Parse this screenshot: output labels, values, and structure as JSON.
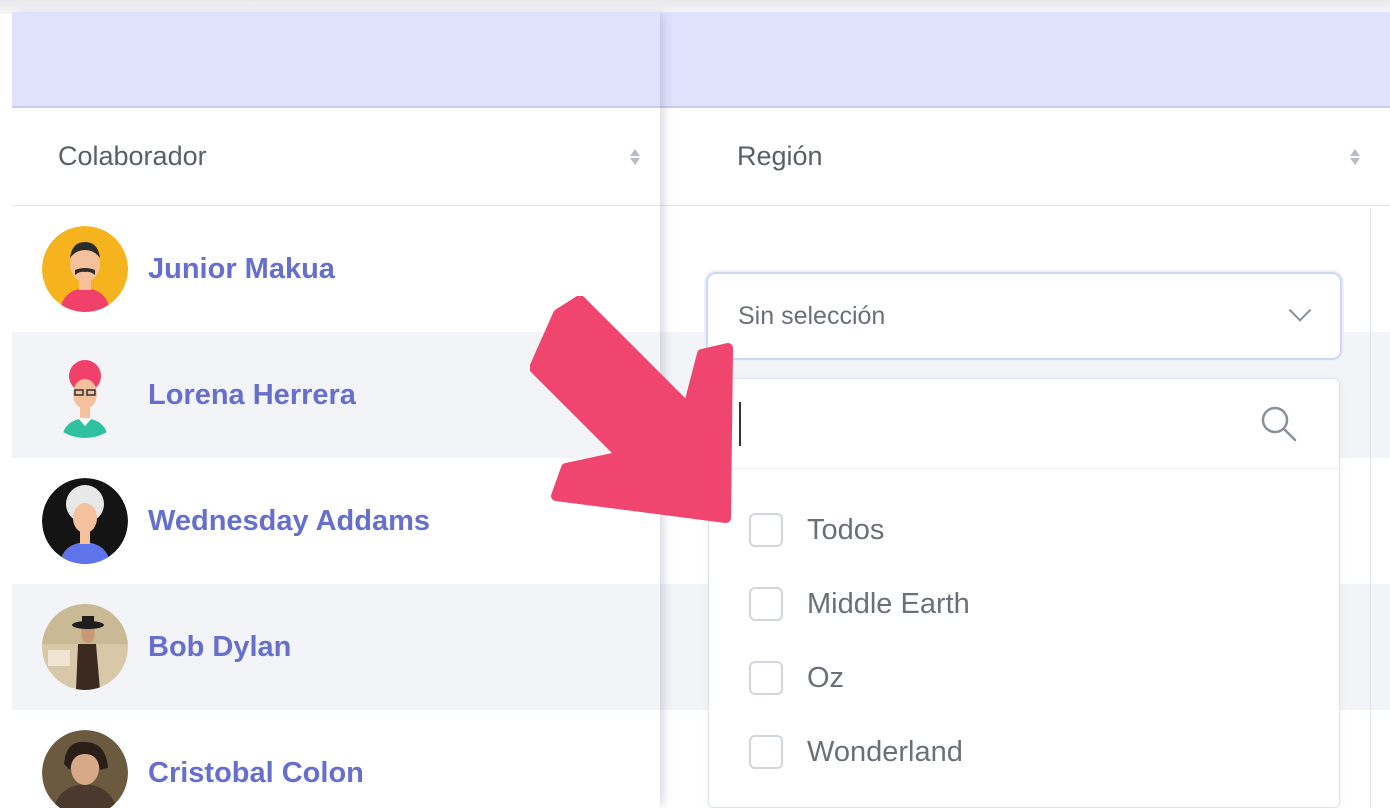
{
  "table": {
    "columns": [
      {
        "label": "Colaborador",
        "sort": "sortable"
      },
      {
        "label": "Región",
        "sort": "sortable"
      }
    ],
    "collaborators": [
      {
        "name": "Junior Makua",
        "avatar": "avatar-mustache-man"
      },
      {
        "name": "Lorena Herrera",
        "avatar": "avatar-pink-hair-woman"
      },
      {
        "name": "Wednesday Addams",
        "avatar": "avatar-gray-hair-woman"
      },
      {
        "name": "Bob Dylan",
        "avatar": "avatar-photo-hat-man"
      },
      {
        "name": "Cristobal Colon",
        "avatar": "avatar-portrait-painting"
      }
    ]
  },
  "region_filter": {
    "selected_value": "Sin selección",
    "search_value": "",
    "options": [
      "Todos",
      "Middle Earth",
      "Oz",
      "Wonderland"
    ]
  },
  "annotation": {
    "type": "arrow-icon",
    "color": "#f0456e"
  },
  "colors": {
    "header_band": "#e0e2fc",
    "name_link": "#6670cc",
    "row_stripe": "#f3f4f8"
  }
}
